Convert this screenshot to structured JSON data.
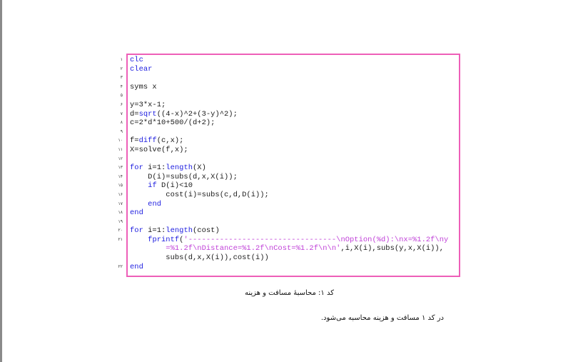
{
  "document": {
    "caption": "کد ۱: محاسبهٔ مسافت و هزینه",
    "paragraph": "در کد ۱ مسافت و هزینه محاسبه می‌شود."
  },
  "listing": {
    "border_color": "#ee5fb8",
    "keyword_color": "#2020e0",
    "string_color": "#c040d8",
    "line_numbers": [
      "۱",
      "۲",
      "۳",
      "۴",
      "۵",
      "۶",
      "۷",
      "۸",
      "۹",
      "۱۰",
      "۱۱",
      "۱۲",
      "۱۳",
      "۱۴",
      "۱۵",
      "۱۶",
      "۱۷",
      "۱۸",
      "۱۹",
      "۲۰",
      "۲۱",
      "",
      "",
      "۲۲"
    ],
    "lines": [
      [
        {
          "t": "clc",
          "c": "kw"
        }
      ],
      [
        {
          "t": "clear",
          "c": "kw"
        }
      ],
      [],
      [
        {
          "t": "syms x",
          "c": ""
        }
      ],
      [],
      [
        {
          "t": "y=3*x-1;",
          "c": ""
        }
      ],
      [
        {
          "t": "d=",
          "c": ""
        },
        {
          "t": "sqrt",
          "c": "kw"
        },
        {
          "t": "((4-x)^2+(3-y)^2);",
          "c": ""
        }
      ],
      [
        {
          "t": "c=2*d*10+500/(d+2);",
          "c": ""
        }
      ],
      [],
      [
        {
          "t": "f=",
          "c": ""
        },
        {
          "t": "diff",
          "c": "kw"
        },
        {
          "t": "(c,x);",
          "c": ""
        }
      ],
      [
        {
          "t": "X=solve(f,x);",
          "c": ""
        }
      ],
      [],
      [
        {
          "t": "for",
          "c": "kw"
        },
        {
          "t": " i=1:",
          "c": ""
        },
        {
          "t": "length",
          "c": "kw"
        },
        {
          "t": "(X)",
          "c": ""
        }
      ],
      [
        {
          "t": "    D(i)=subs(d,x,X(i));",
          "c": ""
        }
      ],
      [
        {
          "t": "    ",
          "c": ""
        },
        {
          "t": "if",
          "c": "kw"
        },
        {
          "t": " D(i)<10",
          "c": ""
        }
      ],
      [
        {
          "t": "        cost(i)=subs(c,d,D(i));",
          "c": ""
        }
      ],
      [
        {
          "t": "    ",
          "c": ""
        },
        {
          "t": "end",
          "c": "kw"
        }
      ],
      [
        {
          "t": "end",
          "c": "kw"
        }
      ],
      [],
      [
        {
          "t": "for",
          "c": "kw"
        },
        {
          "t": " i=1:",
          "c": ""
        },
        {
          "t": "length",
          "c": "kw"
        },
        {
          "t": "(cost)",
          "c": ""
        }
      ],
      [
        {
          "t": "    ",
          "c": ""
        },
        {
          "t": "fprintf",
          "c": "kw"
        },
        {
          "t": "(",
          "c": ""
        },
        {
          "t": "'---------------------------------\\nOption(%d):\\nx=%1.2f\\ny",
          "c": "str"
        }
      ],
      [
        {
          "t": "        ",
          "c": ""
        },
        {
          "t": "=%1.2f\\nDistance=%1.2f\\nCost=%1.2f\\n\\n'",
          "c": "str"
        },
        {
          "t": ",i,X(i),subs(y,x,X(i)),",
          "c": ""
        }
      ],
      [
        {
          "t": "        subs(d,x,X(i)),cost(i))",
          "c": ""
        }
      ],
      [
        {
          "t": "end",
          "c": "kw"
        }
      ]
    ]
  }
}
